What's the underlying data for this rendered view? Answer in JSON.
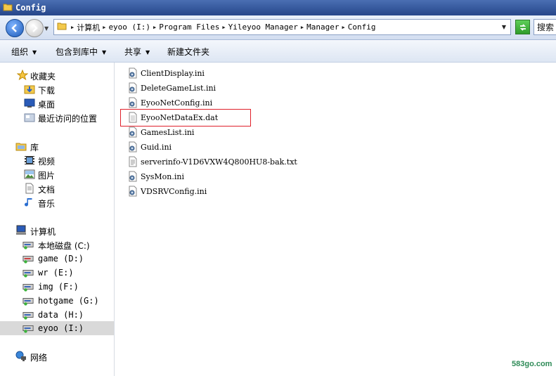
{
  "window": {
    "title": "Config"
  },
  "address": {
    "crumbs": [
      "计算机",
      "eyoo (I:)",
      "Program Files",
      "Yileyoo Manager",
      "Manager",
      "Config"
    ],
    "search_placeholder": "搜索"
  },
  "toolbar": {
    "organize": "组织",
    "include_in_library": "包含到库中",
    "share": "共享",
    "new_folder": "新建文件夹"
  },
  "nav": {
    "favorites": {
      "label": "收藏夹",
      "items": [
        "下载",
        "桌面",
        "最近访问的位置"
      ]
    },
    "libraries": {
      "label": "库",
      "items": [
        "视频",
        "图片",
        "文档",
        "音乐"
      ]
    },
    "computer": {
      "label": "计算机",
      "drives": [
        "本地磁盘 (C:)",
        "game (D:)",
        "wr (E:)",
        "img (F:)",
        "hotgame (G:)",
        "data (H:)",
        "eyoo (I:)"
      ],
      "selected_drive": "eyoo (I:)"
    },
    "network": {
      "label": "网络"
    }
  },
  "files": [
    {
      "name": "ClientDisplay.ini",
      "icon": "ini-settings-icon"
    },
    {
      "name": "DeleteGameList.ini",
      "icon": "ini-settings-icon"
    },
    {
      "name": "EyooNetConfig.ini",
      "icon": "ini-settings-icon"
    },
    {
      "name": "EyooNetDataEx.dat",
      "icon": "dat-file-icon",
      "highlighted": true
    },
    {
      "name": "GamesList.ini",
      "icon": "ini-settings-icon"
    },
    {
      "name": "Guid.ini",
      "icon": "ini-settings-icon"
    },
    {
      "name": "serverinfo-V1D6VXW4Q800HU8-bak.txt",
      "icon": "text-file-icon"
    },
    {
      "name": "SysMon.ini",
      "icon": "ini-settings-icon"
    },
    {
      "name": "VDSRVConfig.ini",
      "icon": "ini-settings-icon"
    }
  ],
  "watermark": "583go.com",
  "colors": {
    "title_bar": "#26468a",
    "highlight_box": "#e0202a",
    "watermark": "#2e8b57"
  }
}
